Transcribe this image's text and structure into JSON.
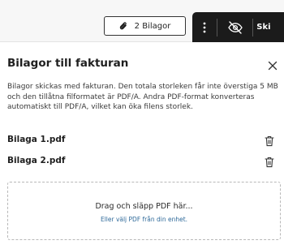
{
  "toolbar": {
    "attachments_button_label": "2 Bilagor",
    "attachments_icon": "paperclip-icon",
    "more_icon": "more-vertical-icon",
    "visibility_icon": "eye-off-icon",
    "truncated_label": "Ski"
  },
  "panel": {
    "title": "Bilagor till fakturan",
    "close_icon": "close-icon",
    "description": "Bilagor skickas med fakturan. Den totala storleken får inte överstiga 5 MB och den tillåtna filformatet är PDF/A. Andra PDF-format konverteras automatiskt till PDF/A, vilket kan öka filens storlek.",
    "files": [
      {
        "name": "Bilaga 1.pdf",
        "delete_icon": "trash-icon"
      },
      {
        "name": "Bilaga 2.pdf",
        "delete_icon": "trash-icon"
      }
    ],
    "dropzone": {
      "main_text": "Drag och släpp PDF här...",
      "sub_text": "Eller välj PDF från din enhet."
    }
  },
  "colors": {
    "toolbar_dark": "#1b1b1b",
    "link": "#2f6a9a",
    "top_background": "#f7f7f7"
  }
}
